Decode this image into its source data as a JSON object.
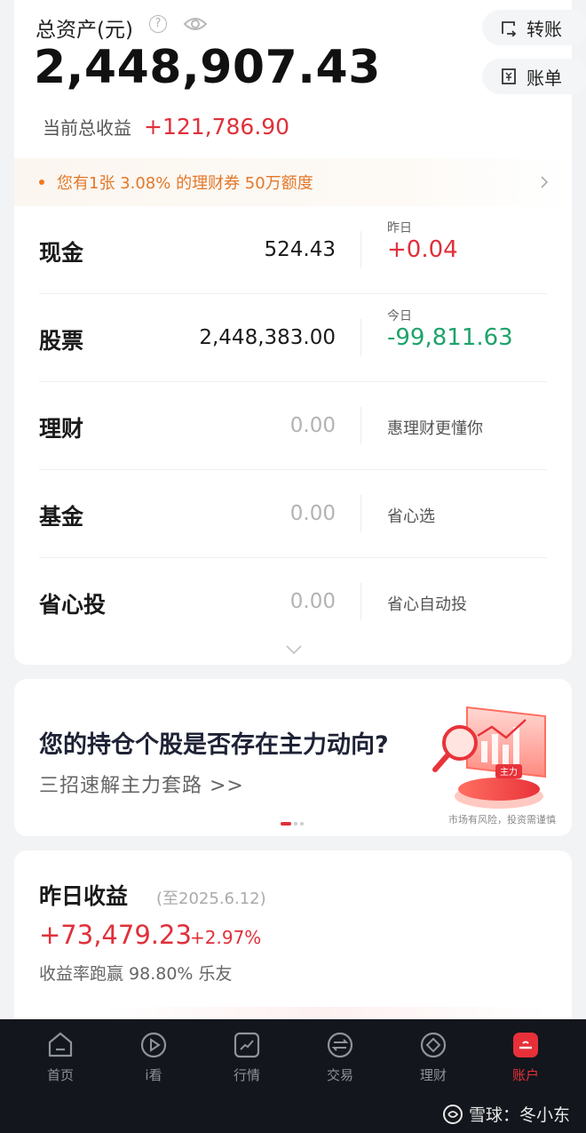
{
  "header": {
    "total_assets_label": "总资产(元)",
    "help_glyph": "?",
    "total_assets_value": "2,448,907.43",
    "transfer_label": "转账",
    "bill_label": "账单",
    "total_profit_label": "当前总收益",
    "total_profit_value": "+121,786.90"
  },
  "coupon": {
    "text": "您有1张 3.08% 的理财券 50万额度"
  },
  "rows": [
    {
      "name": "现金",
      "value": "524.43",
      "sub_label": "昨日",
      "change": "+0.04"
    },
    {
      "name": "股票",
      "value": "2,448,383.00",
      "sub_label": "今日",
      "change": "-99,811.63"
    },
    {
      "name": "理财",
      "value": "0.00",
      "hint": "惠理财更懂你"
    },
    {
      "name": "基金",
      "value": "0.00",
      "hint": "省心选"
    },
    {
      "name": "省心投",
      "value": "0.00",
      "hint": "省心自动投"
    }
  ],
  "banner": {
    "title": "您的持仓个股是否存在主力动向?",
    "subtitle": "三招速解主力套路 >>",
    "art_label": "主力",
    "risk_note": "市场有风险，投资需谨慎",
    "active_index": 0,
    "total": 3
  },
  "earnings": {
    "title": "昨日收益",
    "date": "(至2025.6.12)",
    "value": "+73,479.23",
    "percent": "+2.97%",
    "note": "收益率跑赢 98.80% 乐友"
  },
  "nav": {
    "items": [
      {
        "label": "首页",
        "icon": "home-icon"
      },
      {
        "label": "i看",
        "icon": "play-icon"
      },
      {
        "label": "行情",
        "icon": "chart-icon"
      },
      {
        "label": "交易",
        "icon": "exchange-icon"
      },
      {
        "label": "理财",
        "icon": "diamond-icon"
      },
      {
        "label": "账户",
        "icon": "account-icon"
      }
    ],
    "active": "账户"
  },
  "watermark": {
    "text": "雪球：冬小东"
  },
  "colors": {
    "profit_red": "#e0303a",
    "loss_green": "#1ea36a",
    "coupon_orange": "#e3782a",
    "nav_bg": "#13161c",
    "nav_active": "#e8303a"
  }
}
